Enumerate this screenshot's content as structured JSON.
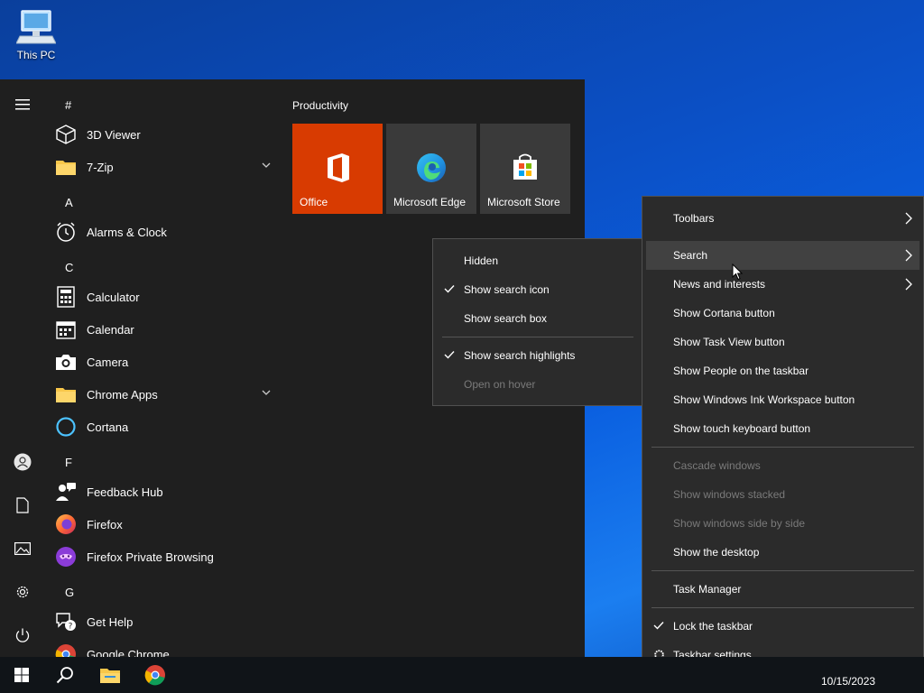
{
  "desktop": {
    "icon_label": "This PC"
  },
  "start_menu": {
    "letters": {
      "hash": "#",
      "a": "A",
      "c": "C",
      "f": "F",
      "g": "G"
    },
    "apps": {
      "viewer3d": "3D Viewer",
      "zip": "7-Zip",
      "alarms": "Alarms & Clock",
      "calculator": "Calculator",
      "calendar": "Calendar",
      "camera": "Camera",
      "chrome_apps": "Chrome Apps",
      "cortana": "Cortana",
      "feedback": "Feedback Hub",
      "firefox": "Firefox",
      "firefox_private": "Firefox Private Browsing",
      "get_help": "Get Help",
      "google_chrome": "Google Chrome"
    },
    "tiles_group": "Productivity",
    "tiles": {
      "office": "Office",
      "edge": "Microsoft Edge",
      "store": "Microsoft Store"
    }
  },
  "context_menu": {
    "toolbars": "Toolbars",
    "search": "Search",
    "news": "News and interests",
    "cortana": "Show Cortana button",
    "task_view": "Show Task View button",
    "people": "Show People on the taskbar",
    "ink": "Show Windows Ink Workspace button",
    "touch_kb": "Show touch keyboard button",
    "cascade": "Cascade windows",
    "stacked": "Show windows stacked",
    "side_by_side": "Show windows side by side",
    "show_desktop": "Show the desktop",
    "task_manager": "Task Manager",
    "lock": "Lock the taskbar",
    "settings": "Taskbar settings"
  },
  "search_submenu": {
    "hidden": "Hidden",
    "icon": "Show search icon",
    "box": "Show search box",
    "highlights": "Show search highlights",
    "hover": "Open on hover"
  },
  "taskbar": {
    "date": "10/15/2023"
  },
  "colors": {
    "office_tile": "#d83b01",
    "tile_bg": "#3a3a3a",
    "menu_bg": "#2b2b2b",
    "start_bg": "#1f1f1f"
  }
}
